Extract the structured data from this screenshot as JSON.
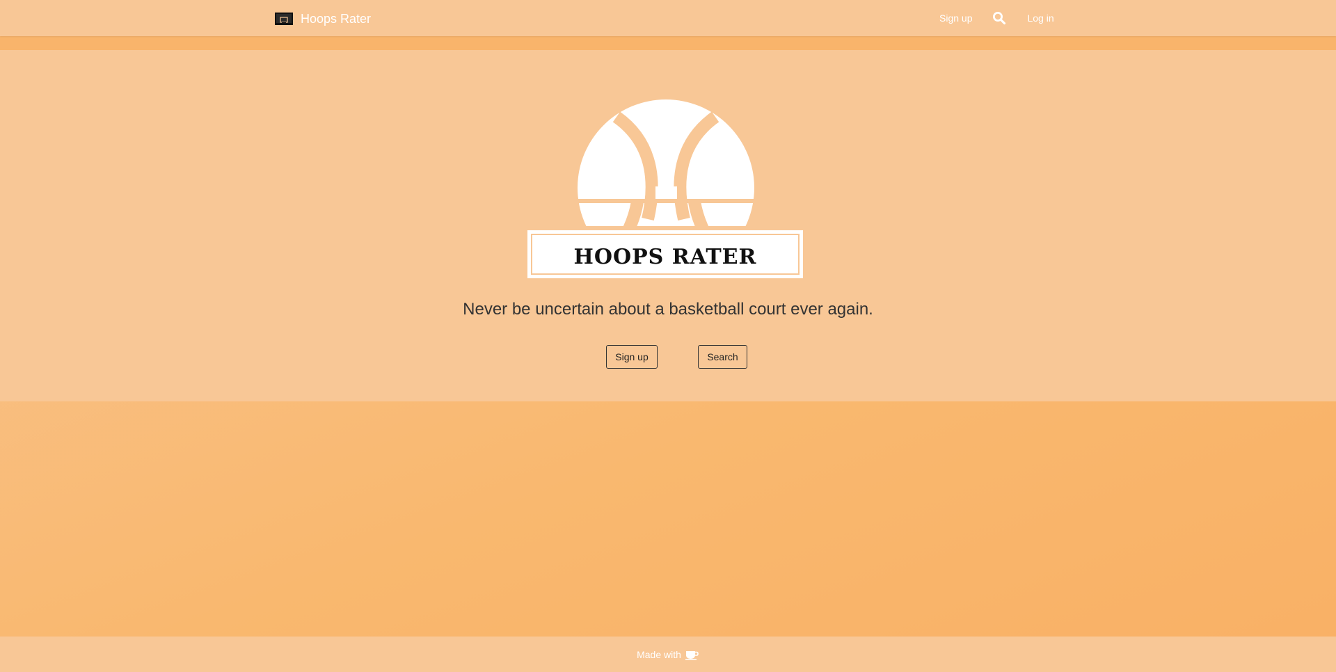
{
  "navbar": {
    "brand_label": "Hoops Rater",
    "brand_icon": "basketball-hoop-icon",
    "signup_label": "Sign up",
    "search_icon": "search-icon",
    "login_label": "Log in"
  },
  "hero": {
    "logo_text": "HOOPS RATER",
    "tagline": "Never be uncertain about a basketball court ever again.",
    "signup_button": "Sign up",
    "search_button": "Search"
  },
  "footer": {
    "text": "Made with",
    "icon": "coffee-cup-icon"
  },
  "colors": {
    "background": "#f8c796",
    "accent_strip": "#f9b46b",
    "gradient_end": "#f9b065",
    "text_dark": "#333333",
    "white": "#ffffff"
  }
}
